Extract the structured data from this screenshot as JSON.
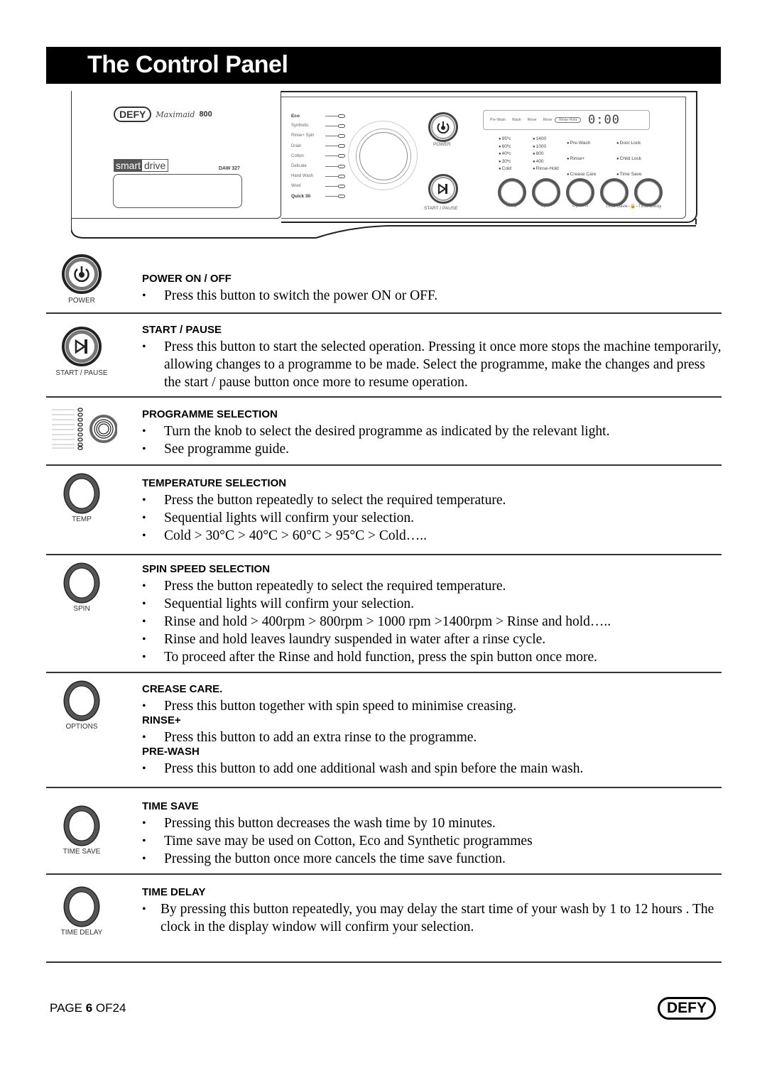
{
  "page_title": "The Control Panel",
  "panel": {
    "brand_logo": "DEFY",
    "brand_sub": "Maximaid",
    "model_number": "800",
    "smartdrive_1": "smart",
    "smartdrive_2": "drive",
    "model_code": "DAW 327",
    "programmes": [
      {
        "label": "Eco",
        "bold": true
      },
      {
        "label": "Synthetic",
        "bold": false
      },
      {
        "label": "Rinse+ Spin",
        "bold": false
      },
      {
        "label": "Drain",
        "bold": false
      },
      {
        "label": "Cotton",
        "bold": false
      },
      {
        "label": "Delicate",
        "bold": false
      },
      {
        "label": "Hand Wash",
        "bold": false
      },
      {
        "label": "Wool",
        "bold": false
      },
      {
        "label": "Quick 30",
        "bold": true
      }
    ],
    "power_label": "POWER",
    "start_pause_label": "START / PAUSE",
    "display": {
      "phases": [
        "Pre-Wash",
        "Wash",
        "Rinse",
        "Rinse"
      ],
      "rinse_hold": "Rinse-Hold",
      "clock": "0:00"
    },
    "temp_indicators": [
      "95ºc",
      "60ºc",
      "40ºc",
      "30ºc",
      "Cold"
    ],
    "spin_indicators": [
      "1400",
      "1000",
      "800",
      "400",
      "Rinse-Hold"
    ],
    "option_indicators": [
      "Pre-Wash",
      "Rinse+",
      "Crease Care"
    ],
    "status_indicators": [
      "Door Lock",
      "Child Lock",
      "Time Save"
    ],
    "button_labels": [
      "Temp",
      "Spin",
      "Options",
      "Time Save–🔒–Time Delay"
    ]
  },
  "sections": [
    {
      "icon_caption": "POWER",
      "heading": "POWER ON / OFF",
      "bullets": [
        "Press this button to switch the power ON or OFF."
      ]
    },
    {
      "icon_caption": "START / PAUSE",
      "heading": "START / PAUSE",
      "bullets": [
        "Press this button  to start the selected operation. Pressing it once more stops the machine temporarily, allowing changes to a programme to be made.  Select the programme, make the changes and press the start / pause button once more to resume operation."
      ]
    },
    {
      "icon_caption": "",
      "heading": "PROGRAMME SELECTION",
      "bullets": [
        "Turn the knob to select the desired programme as indicated by the relevant light.",
        "See programme guide."
      ]
    },
    {
      "icon_caption": "TEMP",
      "heading": "TEMPERATURE SELECTION",
      "bullets": [
        "Press the button repeatedly to select the required temperature.",
        "Sequential lights will confirm your selection.",
        "Cold > 30°C > 40°C > 60°C > 95°C > Cold….."
      ]
    },
    {
      "icon_caption": "SPIN",
      "heading": "SPIN SPEED SELECTION",
      "bullets": [
        "Press the button repeatedly to select the required temperature.",
        "Sequential lights will confirm your selection.",
        "Rinse and hold > 400rpm > 800rpm > 1000 rpm >1400rpm > Rinse and hold…..",
        "Rinse and hold leaves laundry suspended in water after a rinse cycle.",
        "To proceed after the Rinse and hold function, press the spin button once more."
      ]
    },
    {
      "icon_caption": "OPTIONS",
      "subsections": [
        {
          "heading": "CREASE CARE.",
          "bullets": [
            "Press this button together with spin speed to minimise creasing."
          ]
        },
        {
          "heading": "RINSE+",
          "bullets": [
            "Press this button to add an extra rinse to the programme."
          ]
        },
        {
          "heading": "PRE-WASH",
          "bullets": [
            "Press this button to add one additional wash and spin before the main wash."
          ]
        }
      ]
    },
    {
      "icon_caption": "TIME SAVE",
      "heading": "TIME SAVE",
      "bullets": [
        "Pressing this button decreases the wash time by 10 minutes.",
        "Time save may be used on Cotton, Eco and Synthetic programmes",
        "Pressing the button once more cancels the time save function."
      ]
    },
    {
      "icon_caption": "TIME DELAY",
      "heading": "TIME DELAY",
      "bullets": [
        "By pressing this button repeatedly, you may delay the start time of your wash by 1 to 12 hours . The clock in the display window will confirm your selection."
      ]
    }
  ],
  "footer": {
    "page_prefix": "PAGE ",
    "page_number": "6",
    "page_suffix": " OF24",
    "logo": "DEFY"
  }
}
